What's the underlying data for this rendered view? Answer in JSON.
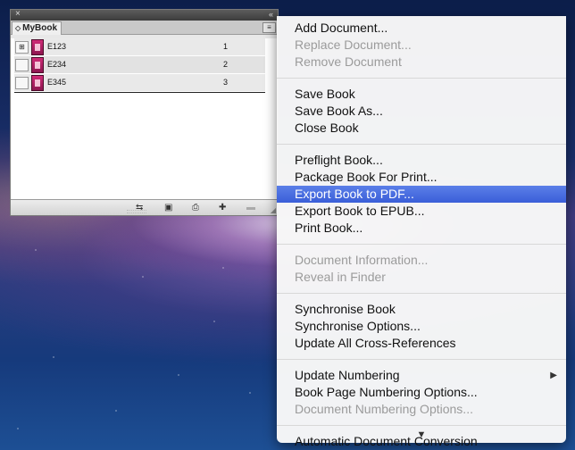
{
  "panel": {
    "tab_label": "MyBook",
    "tab_arrows": "◇",
    "close_glyph": "×",
    "collapse_glyph": "«",
    "menu_button_glyph": "≡",
    "rows": [
      {
        "name": "E123",
        "pages": "1",
        "check": "⊞"
      },
      {
        "name": "E234",
        "pages": "2",
        "check": ""
      },
      {
        "name": "E345",
        "pages": "3",
        "check": ""
      }
    ],
    "bottom_buttons": {
      "sync": "⇆",
      "save": "▣",
      "print": "⎙",
      "add": "✚",
      "remove": "▬"
    },
    "resize_glyph": "◢"
  },
  "menu": {
    "groups": [
      {
        "items": [
          {
            "label": "Add Document...",
            "enabled": true
          },
          {
            "label": "Replace Document...",
            "enabled": false
          },
          {
            "label": "Remove Document",
            "enabled": false
          }
        ]
      },
      {
        "items": [
          {
            "label": "Save Book",
            "enabled": true
          },
          {
            "label": "Save Book As...",
            "enabled": true
          },
          {
            "label": "Close Book",
            "enabled": true
          }
        ]
      },
      {
        "items": [
          {
            "label": "Preflight Book...",
            "enabled": true
          },
          {
            "label": "Package Book For Print...",
            "enabled": true
          },
          {
            "label": "Export Book to PDF...",
            "enabled": true,
            "highlighted": true
          },
          {
            "label": "Export Book to EPUB...",
            "enabled": true
          },
          {
            "label": "Print Book...",
            "enabled": true
          }
        ]
      },
      {
        "items": [
          {
            "label": "Document Information...",
            "enabled": false
          },
          {
            "label": "Reveal in Finder",
            "enabled": false
          }
        ]
      },
      {
        "items": [
          {
            "label": "Synchronise Book",
            "enabled": true
          },
          {
            "label": "Synchronise Options...",
            "enabled": true
          },
          {
            "label": "Update All Cross-References",
            "enabled": true
          }
        ]
      },
      {
        "items": [
          {
            "label": "Update Numbering",
            "enabled": true,
            "submenu": true
          },
          {
            "label": "Book Page Numbering Options...",
            "enabled": true
          },
          {
            "label": "Document Numbering Options...",
            "enabled": false
          }
        ]
      },
      {
        "items": [
          {
            "label": "Automatic Document Conversion",
            "enabled": true
          }
        ]
      }
    ],
    "submenu_glyph": "▶",
    "scroll_down_glyph": "▼",
    "highlight_color": "#3a5ed8"
  }
}
